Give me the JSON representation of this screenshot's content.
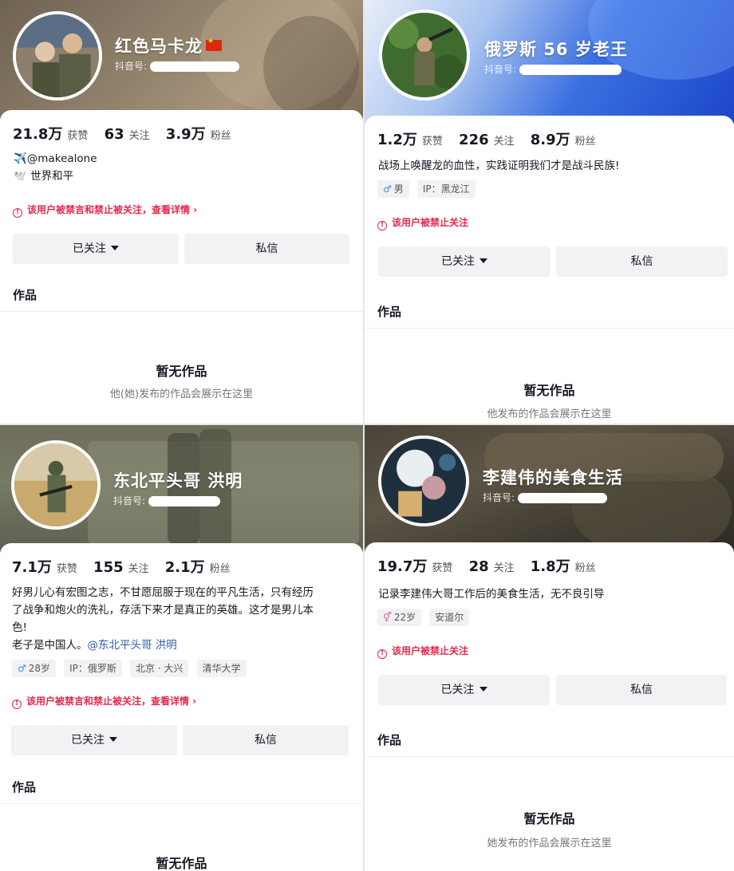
{
  "panels": [
    {
      "name": "红色马卡龙",
      "douyin_label": "抖音号:",
      "likes_num": "21.8万",
      "likes_label": "获赞",
      "following_num": "63",
      "following_label": "关注",
      "fans_num": "3.9万",
      "fans_label": "粉丝",
      "bio_line1": "✈️@makealone",
      "bio_line2": "🕊️ 世界和平",
      "warning": "该用户被禁言和禁止被关注，查看详情 ›",
      "follow_btn": "已关注",
      "message_btn": "私信",
      "works_label": "作品",
      "empty_title": "暂无作品",
      "empty_sub": "他(她)发布的作品会展示在这里"
    },
    {
      "name": "俄罗斯 56 岁老王",
      "douyin_label": "抖音号:",
      "likes_num": "1.2万",
      "likes_label": "获赞",
      "following_num": "226",
      "following_label": "关注",
      "fans_num": "8.9万",
      "fans_label": "粉丝",
      "bio": "战场上唤醒龙的血性，实践证明我们才是战斗民族!",
      "gender": "男",
      "ip": "IP：黑龙江",
      "warning": "该用户被禁止关注",
      "follow_btn": "已关注",
      "message_btn": "私信",
      "works_label": "作品",
      "empty_title": "暂无作品",
      "empty_sub": "他发布的作品会展示在这里"
    },
    {
      "name": "东北平头哥  洪明",
      "douyin_label": "抖音号:",
      "likes_num": "7.1万",
      "likes_label": "获赞",
      "following_num": "155",
      "following_label": "关注",
      "fans_num": "2.1万",
      "fans_label": "粉丝",
      "bio_line1": "好男儿心有宏图之志，不甘愿屈服于现在的平凡生活，只有经历",
      "bio_line2": "了战争和炮火的洗礼，存活下来才是真正的英雄。这才是男儿本",
      "bio_line3": "色!",
      "bio_line4": "老子是中国人。",
      "bio_mention": "@东北平头哥 洪明",
      "age": "28岁",
      "ip": "IP：俄罗斯",
      "location": "北京 · 大兴",
      "school": "清华大学",
      "warning": "该用户被禁言和禁止被关注，查看详情 ›",
      "follow_btn": "已关注",
      "message_btn": "私信",
      "works_label": "作品",
      "empty_title": "暂无作品"
    },
    {
      "name": "李建伟的美食生活",
      "douyin_label": "抖音号:",
      "likes_num": "19.7万",
      "likes_label": "获赞",
      "following_num": "28",
      "following_label": "关注",
      "fans_num": "1.8万",
      "fans_label": "粉丝",
      "bio": "记录李建伟大哥工作后的美食生活，无不良引导",
      "age": "22岁",
      "location": "安道尔",
      "warning": "该用户被禁止关注",
      "follow_btn": "已关注",
      "message_btn": "私信",
      "works_label": "作品",
      "empty_title": "暂无作品",
      "empty_sub": "她发布的作品会展示在这里"
    }
  ],
  "colors": {
    "warning_red": "#e3284e",
    "link_blue": "#2b5ea8",
    "male_blue": "#3d8bd9",
    "female_pink": "#e85a94",
    "button_bg": "#f1f2f4"
  },
  "icons": [
    "flag-cn-icon",
    "warning-icon",
    "caret-down-icon",
    "male-icon",
    "female-icon"
  ]
}
